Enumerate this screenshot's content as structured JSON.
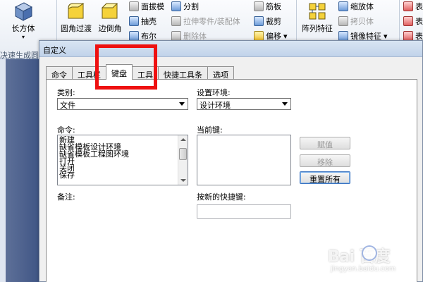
{
  "ribbon": {
    "cuboid": "长方体",
    "quick_gen": "决速生成圆",
    "fillet": "圆角过渡",
    "chamfer": "边倒角",
    "face_draft": "面拔模",
    "shell": "抽壳",
    "boolean": "布尔",
    "split": "分割",
    "stretch_part": "拉伸零件/装配体",
    "delete_body": "删除体",
    "rib": "筋板",
    "cut": "裁剪",
    "move": "偏移",
    "pattern": "阵列特征",
    "scale_body": "缩放体",
    "copy_body": "拷贝体",
    "mirror": "镜像特征",
    "more1": "表",
    "more2": "表",
    "more3": "表"
  },
  "dialog": {
    "title": "自定义",
    "tabs": [
      "命令",
      "工具栏",
      "键盘",
      "工具",
      "快捷工具条",
      "选项"
    ],
    "active_tab": "键盘",
    "category_label": "类别:",
    "category_value": "文件",
    "env_label": "设置环境:",
    "env_value": "设计环境",
    "command_label": "命令:",
    "commands": [
      "新建",
      "缺省模板设计环境",
      "缺省模板工程图环境",
      "打开",
      "关闭",
      "保存"
    ],
    "current_key_label": "当前键:",
    "btn_assign": "赋值",
    "btn_remove": "移除",
    "btn_reset": "重置所有",
    "note_label": "备注:",
    "new_shortcut_label": "按新的快捷键:",
    "new_shortcut_value": ""
  },
  "watermark": {
    "main": "Bai  百度",
    "sub": "jingyan.baidu.com"
  },
  "colors": {
    "highlight": "#ee1010",
    "panel_bg": "#ffffff",
    "dialog_bg": "#f0f0f0"
  }
}
